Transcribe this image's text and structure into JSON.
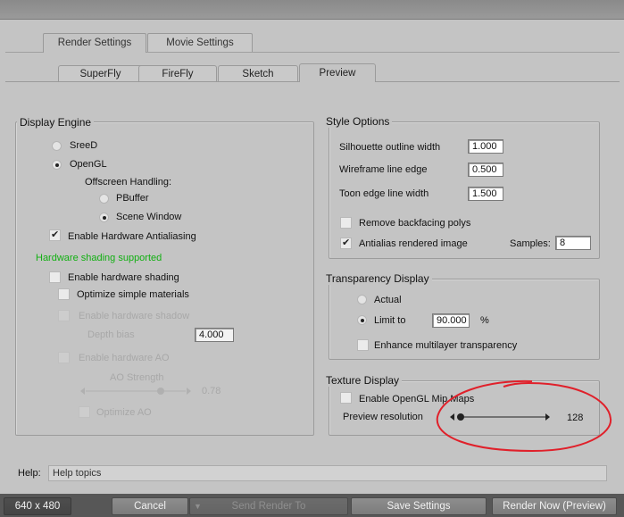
{
  "top_tabs": [
    {
      "label": "Render Settings",
      "active": true
    },
    {
      "label": "Movie Settings",
      "active": false
    }
  ],
  "sub_tabs": [
    {
      "label": "SuperFly",
      "active": false
    },
    {
      "label": "FireFly",
      "active": false
    },
    {
      "label": "Sketch",
      "active": false
    },
    {
      "label": "Preview",
      "active": true
    }
  ],
  "display_engine": {
    "title": "Display Engine",
    "sreed": "SreeD",
    "opengl": "OpenGL",
    "offscreen_label": "Offscreen Handling:",
    "pbuffer": "PBuffer",
    "scene_window": "Scene Window",
    "hw_antialias": "Enable Hardware Antialiasing",
    "hw_supported": "Hardware shading supported",
    "hw_shading": "Enable hardware shading",
    "optimize_simple": "Optimize simple materials",
    "hw_shadow": "Enable hardware shadow",
    "depth_bias_label": "Depth bias",
    "depth_bias_value": "4.000",
    "hw_ao": "Enable hardware AO",
    "ao_strength_label": "AO Strength",
    "ao_strength_value": "0.78",
    "optimize_ao": "Optimize AO"
  },
  "style_options": {
    "title": "Style Options",
    "silhouette_label": "Silhouette outline width",
    "silhouette_value": "1.000",
    "wireframe_label": "Wireframe line edge",
    "wireframe_value": "0.500",
    "toon_label": "Toon edge line width",
    "toon_value": "1.500",
    "remove_backfacing": "Remove backfacing polys",
    "antialias": "Antialias rendered image",
    "samples_label": "Samples:",
    "samples_value": "8"
  },
  "transparency": {
    "title": "Transparency Display",
    "actual": "Actual",
    "limit_to": "Limit to",
    "limit_value": "90.000",
    "percent": "%",
    "enhance": "Enhance multilayer transparency"
  },
  "texture": {
    "title": "Texture Display",
    "mip_maps": "Enable OpenGL Mip Maps",
    "preview_res_label": "Preview resolution",
    "preview_res_value": "128",
    "slider_level": 0.0
  },
  "help": {
    "label": "Help:",
    "text": "Help topics"
  },
  "bottom": {
    "size": "640 x 480",
    "cancel": "Cancel",
    "send_render_to": "Send Render To",
    "save_settings": "Save Settings",
    "render_now": "Render Now (Preview)"
  },
  "annotation_color": "#e0202a"
}
